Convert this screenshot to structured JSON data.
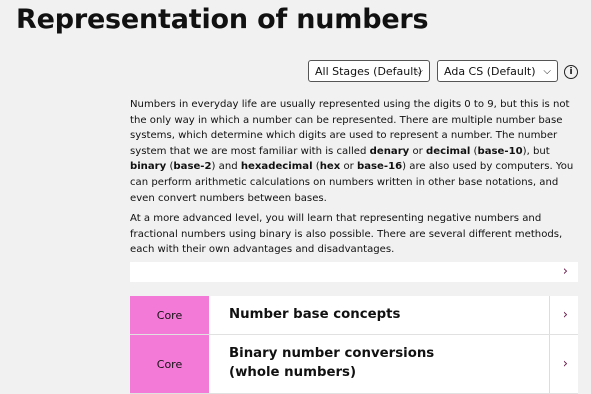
{
  "page": {
    "title": "Representation of numbers"
  },
  "filters": {
    "stage": {
      "selected": "All Stages (Default)"
    },
    "course": {
      "selected": "Ada CS (Default)"
    },
    "info_glyph": "i",
    "chevron_glyph": "⌵"
  },
  "intro": {
    "p1": [
      "Numbers in everyday life are usually represented using the digits 0 to 9, but this is not the only way in which a number can be represented. There are multiple number base systems, which determine which digits are used to represent a number. The number system that we are most familiar with is called ",
      "denary",
      " or ",
      "decimal",
      " (",
      "base-10",
      "), but ",
      "binary",
      " (",
      "base-2",
      ") and ",
      "hexadecimal",
      " (",
      "hex",
      " or ",
      "base-16",
      ") are also used by computers. You can perform arithmetic calculations on numbers written in other base notations, and even convert numbers between bases."
    ],
    "p2": "At a more advanced level, you will learn that representing negative numbers and fractional numbers using binary is also possible. There are several different methods, each with their own advantages and disadvantages."
  },
  "expand_arrow": "›",
  "topics": [
    {
      "badge": "Core",
      "title": "Number base concepts",
      "arrow": "›"
    },
    {
      "badge": "Core",
      "title": "Binary number conversions (whole numbers)",
      "arrow": "›"
    }
  ],
  "colors": {
    "badge_bg": "#f47ad8",
    "page_bg": "#f1f1f1",
    "arrow": "#6b1a4a"
  }
}
